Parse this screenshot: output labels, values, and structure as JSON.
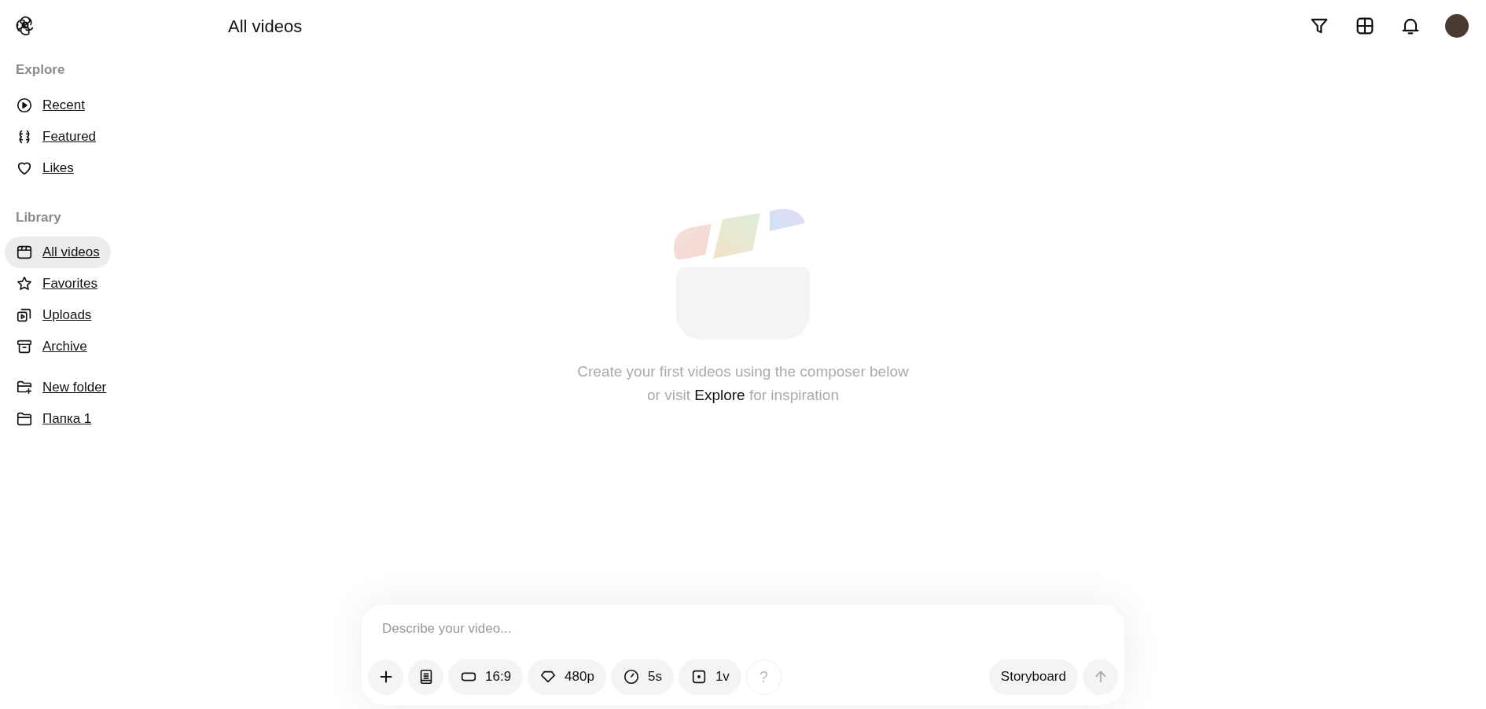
{
  "header": {
    "title": "All videos"
  },
  "sidebar": {
    "sections": [
      {
        "heading": "Explore",
        "items": [
          {
            "label": "Recent",
            "selected": false
          },
          {
            "label": "Featured",
            "selected": false
          },
          {
            "label": "Likes",
            "selected": false
          }
        ]
      },
      {
        "heading": "Library",
        "items": [
          {
            "label": "All videos",
            "selected": true
          },
          {
            "label": "Favorites",
            "selected": false
          },
          {
            "label": "Uploads",
            "selected": false
          },
          {
            "label": "Archive",
            "selected": false
          }
        ]
      },
      {
        "items": [
          {
            "label": "New folder",
            "selected": false
          },
          {
            "label": "Папка 1",
            "selected": false
          }
        ]
      }
    ]
  },
  "empty_state": {
    "line_1": "Create your first videos using the composer below",
    "line_2_before": "or visit",
    "link": "Explore",
    "line_2_after": "for inspiration"
  },
  "composer": {
    "placeholder": "Describe your video...",
    "chips": [
      {
        "kind": "add"
      },
      {
        "kind": "presets"
      },
      {
        "kind": "aspect",
        "label": "16:9"
      },
      {
        "kind": "resolution",
        "label": "480p"
      },
      {
        "kind": "duration",
        "label": "5s"
      },
      {
        "kind": "variations",
        "label": "1v"
      },
      {
        "kind": "help",
        "label": "?"
      }
    ],
    "storyboard": "Storyboard",
    "send": {
      "disabled": true
    }
  }
}
